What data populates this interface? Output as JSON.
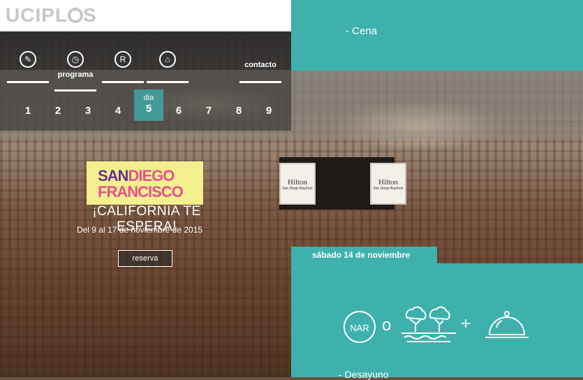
{
  "header": {
    "logo_text": "UCIPL",
    "logo_suffix": "S",
    "buttons": [
      {
        "name": "chat-icon",
        "glyph": "⊕"
      },
      {
        "name": "settings-icon",
        "glyph": "⚙"
      }
    ]
  },
  "top_panel": {
    "item": "- Cena"
  },
  "nav": {
    "items": [
      {
        "name": "info",
        "label": "",
        "glyph": "✎"
      },
      {
        "name": "programa",
        "label": "programa",
        "glyph": "◷"
      },
      {
        "name": "registro",
        "label": "",
        "glyph": "R"
      },
      {
        "name": "hotel",
        "label": "",
        "glyph": "⌂"
      },
      {
        "name": "contacto",
        "label": "contacto",
        "glyph": ""
      }
    ],
    "day_label": "dia",
    "days": [
      "1",
      "2",
      "3",
      "4",
      "5",
      "6",
      "7",
      "8",
      "9"
    ],
    "selected_day": "5"
  },
  "promo": {
    "line1_a": "SAN",
    "line1_b": "DIEGO",
    "line2": "FRANCISCO",
    "tagline": "¡CALIFORNIA TE ESPERA!",
    "dates": "Del 9 al 17 de noviembre de 2015",
    "cta": "reserva"
  },
  "venue": {
    "banner_brand": "Hilton",
    "banner_sub": "San Diego Bayfront"
  },
  "schedule": {
    "date_tab": "sábado 14 de noviembre",
    "nar_label": "NAR",
    "or_label": "o",
    "plus_label": "+",
    "item": "- Desayuno"
  },
  "colors": {
    "teal": "#3eb1ad",
    "logo_gray": "#c7c7c7",
    "promo_bg": "#f4f090",
    "promo_purple": "#6a2e8c",
    "promo_pink": "#e5508c"
  }
}
